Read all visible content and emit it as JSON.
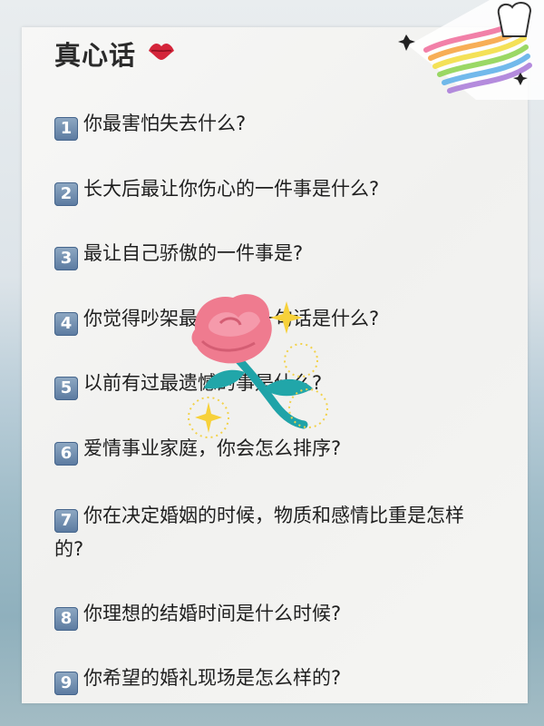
{
  "title": "真心话",
  "questions": [
    {
      "num": "1",
      "text": "你最害怕失去什么?"
    },
    {
      "num": "2",
      "text": "长大后最让你伤心的一件事是什么?"
    },
    {
      "num": "3",
      "text": "最让自己骄傲的一件事是?"
    },
    {
      "num": "4",
      "text": "你觉得吵架最伤人的一句话是什么?"
    },
    {
      "num": "5",
      "text": "以前有过最遗憾的事是什么?"
    },
    {
      "num": "6",
      "text": "爱情事业家庭，你会怎么排序?"
    },
    {
      "num": "7",
      "text": "你在决定婚姻的时候，物质和感情比重是怎样的?"
    },
    {
      "num": "8",
      "text": "你理想的结婚时间是什么时候?"
    },
    {
      "num": "9",
      "text": "你希望的婚礼现场是怎么样的?"
    }
  ],
  "stickers": {
    "lips": "lips-icon",
    "rainbow": "rainbow-icon",
    "rose": "rose-icon",
    "sparkles": "sparkle-icon"
  },
  "colors": {
    "rose_petal": "#ef7b8f",
    "rose_stem": "#1fa3a8",
    "sparkle": "#f7d13a",
    "number_badge": "#6a88ad"
  }
}
